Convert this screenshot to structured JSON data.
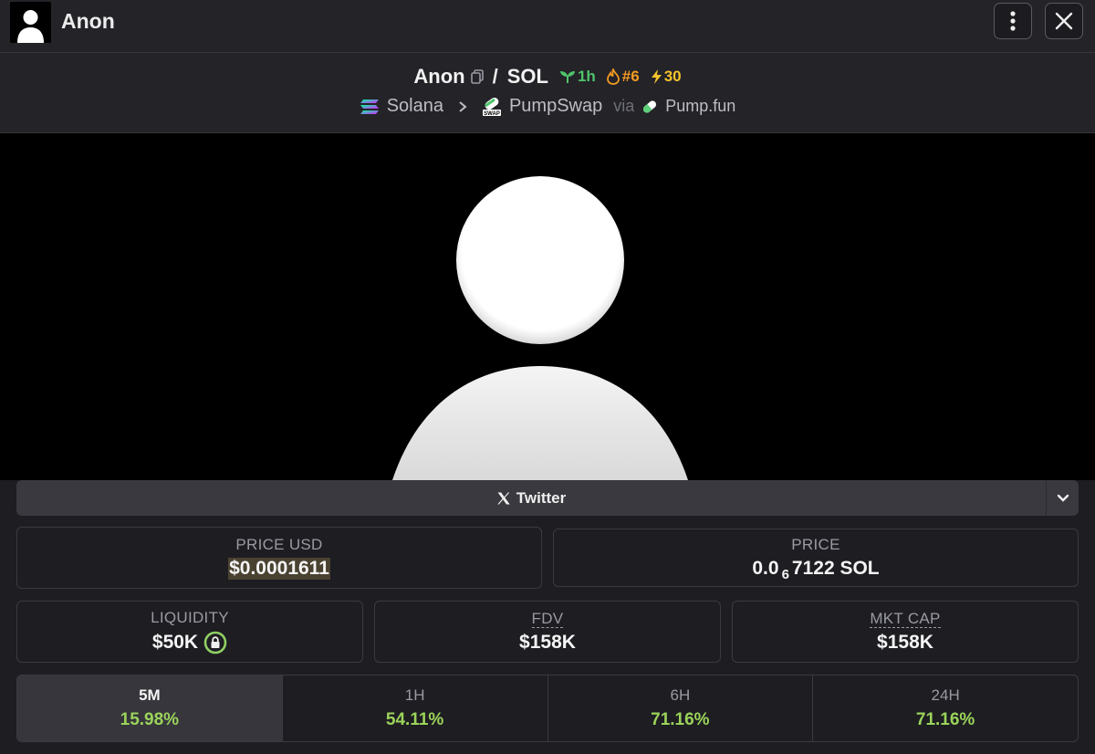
{
  "header": {
    "title": "Anon",
    "avatar_icon": "user-silhouette-icon",
    "menu_icon": "kebab-menu-icon",
    "close_icon": "close-icon"
  },
  "pair": {
    "base": "Anon",
    "separator": "/",
    "quote": "SOL",
    "age": "1h",
    "rank": "#6",
    "boosts": "30"
  },
  "chain": {
    "network": "Solana",
    "dex": "PumpSwap",
    "via_label": "via",
    "launchpad": "Pump.fun"
  },
  "twitter": {
    "label": "Twitter"
  },
  "stats": {
    "price_usd_label": "PRICE USD",
    "price_usd_value": "$0.0001611",
    "price_label": "PRICE",
    "price_prefix": "0.0",
    "price_subscript": "6",
    "price_suffix": "7122 SOL",
    "liquidity_label": "LIQUIDITY",
    "liquidity_value": "$50K",
    "fdv_label": "FDV",
    "fdv_value": "$158K",
    "mktcap_label": "MKT CAP",
    "mktcap_value": "$158K"
  },
  "timeframes": [
    {
      "label": "5M",
      "value": "15.98%",
      "active": true
    },
    {
      "label": "1H",
      "value": "54.11%",
      "active": false
    },
    {
      "label": "6H",
      "value": "71.16%",
      "active": false
    },
    {
      "label": "24H",
      "value": "71.16%",
      "active": false
    }
  ],
  "colors": {
    "positive": "#9bd35a",
    "age_badge": "#4fc46a",
    "rank_badge": "#f39a22",
    "boost_badge": "#f5c32b"
  }
}
